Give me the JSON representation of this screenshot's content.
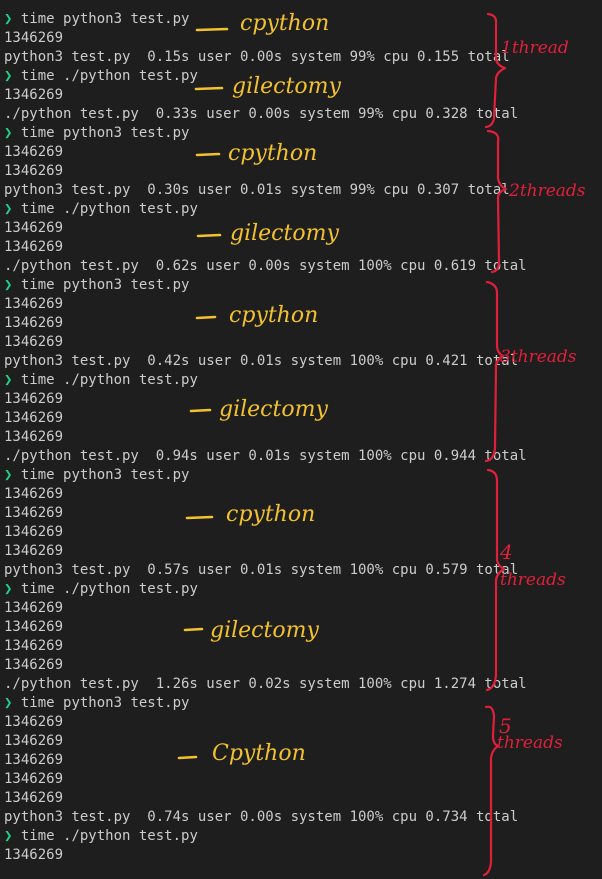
{
  "terminal": {
    "lines": [
      {
        "kind": "prompt",
        "text": "time python3 test.py"
      },
      {
        "kind": "output",
        "text": "1346269"
      },
      {
        "kind": "timing",
        "text": "python3 test.py  0.15s user 0.00s system 99% cpu 0.155 total"
      },
      {
        "kind": "prompt",
        "text": "time ./python test.py"
      },
      {
        "kind": "output",
        "text": "1346269"
      },
      {
        "kind": "timing",
        "text": "./python test.py  0.33s user 0.00s system 99% cpu 0.328 total"
      },
      {
        "kind": "prompt",
        "text": "time python3 test.py"
      },
      {
        "kind": "output",
        "text": "1346269"
      },
      {
        "kind": "output",
        "text": "1346269"
      },
      {
        "kind": "timing",
        "text": "python3 test.py  0.30s user 0.01s system 99% cpu 0.307 total"
      },
      {
        "kind": "prompt",
        "text": "time ./python test.py"
      },
      {
        "kind": "output",
        "text": "1346269"
      },
      {
        "kind": "output",
        "text": "1346269"
      },
      {
        "kind": "timing",
        "text": "./python test.py  0.62s user 0.00s system 100% cpu 0.619 total"
      },
      {
        "kind": "prompt",
        "text": "time python3 test.py"
      },
      {
        "kind": "output",
        "text": "1346269"
      },
      {
        "kind": "output",
        "text": "1346269"
      },
      {
        "kind": "output",
        "text": "1346269"
      },
      {
        "kind": "timing",
        "text": "python3 test.py  0.42s user 0.01s system 100% cpu 0.421 total"
      },
      {
        "kind": "prompt",
        "text": "time ./python test.py"
      },
      {
        "kind": "output",
        "text": "1346269"
      },
      {
        "kind": "output",
        "text": "1346269"
      },
      {
        "kind": "output",
        "text": "1346269"
      },
      {
        "kind": "timing",
        "text": "./python test.py  0.94s user 0.01s system 100% cpu 0.944 total"
      },
      {
        "kind": "prompt",
        "text": "time python3 test.py"
      },
      {
        "kind": "output",
        "text": "1346269"
      },
      {
        "kind": "output",
        "text": "1346269"
      },
      {
        "kind": "output",
        "text": "1346269"
      },
      {
        "kind": "output",
        "text": "1346269"
      },
      {
        "kind": "timing",
        "text": "python3 test.py  0.57s user 0.01s system 100% cpu 0.579 total"
      },
      {
        "kind": "prompt",
        "text": "time ./python test.py"
      },
      {
        "kind": "output",
        "text": "1346269"
      },
      {
        "kind": "output",
        "text": "1346269"
      },
      {
        "kind": "output",
        "text": "1346269"
      },
      {
        "kind": "output",
        "text": "1346269"
      },
      {
        "kind": "timing",
        "text": "./python test.py  1.26s user 0.02s system 100% cpu 1.274 total"
      },
      {
        "kind": "prompt",
        "text": "time python3 test.py"
      },
      {
        "kind": "output",
        "text": "1346269"
      },
      {
        "kind": "output",
        "text": "1346269"
      },
      {
        "kind": "output",
        "text": "1346269"
      },
      {
        "kind": "output",
        "text": "1346269"
      },
      {
        "kind": "output",
        "text": "1346269"
      },
      {
        "kind": "timing",
        "text": "python3 test.py  0.74s user 0.00s system 100% cpu 0.734 total"
      },
      {
        "kind": "prompt",
        "text": "time ./python test.py"
      },
      {
        "kind": "output",
        "text": "1346269"
      }
    ],
    "prompt_symbol": "❯"
  },
  "annotations": {
    "labels": {
      "cpython": "cpython",
      "cpython_cap": "Cpython",
      "gilectomy": "gilectomy"
    },
    "threads": {
      "t1": "1thread",
      "t2": "2threads",
      "t3": "3threads",
      "t4_num": "4",
      "t4_word": "threads",
      "t5_num": "5",
      "t5_word": "threads"
    }
  },
  "colors": {
    "background": "#1e1e1e",
    "text": "#cccccc",
    "prompt_arrow": "#23d18b",
    "annotation_yellow": "#f2c12e",
    "annotation_red": "#e0203a"
  }
}
